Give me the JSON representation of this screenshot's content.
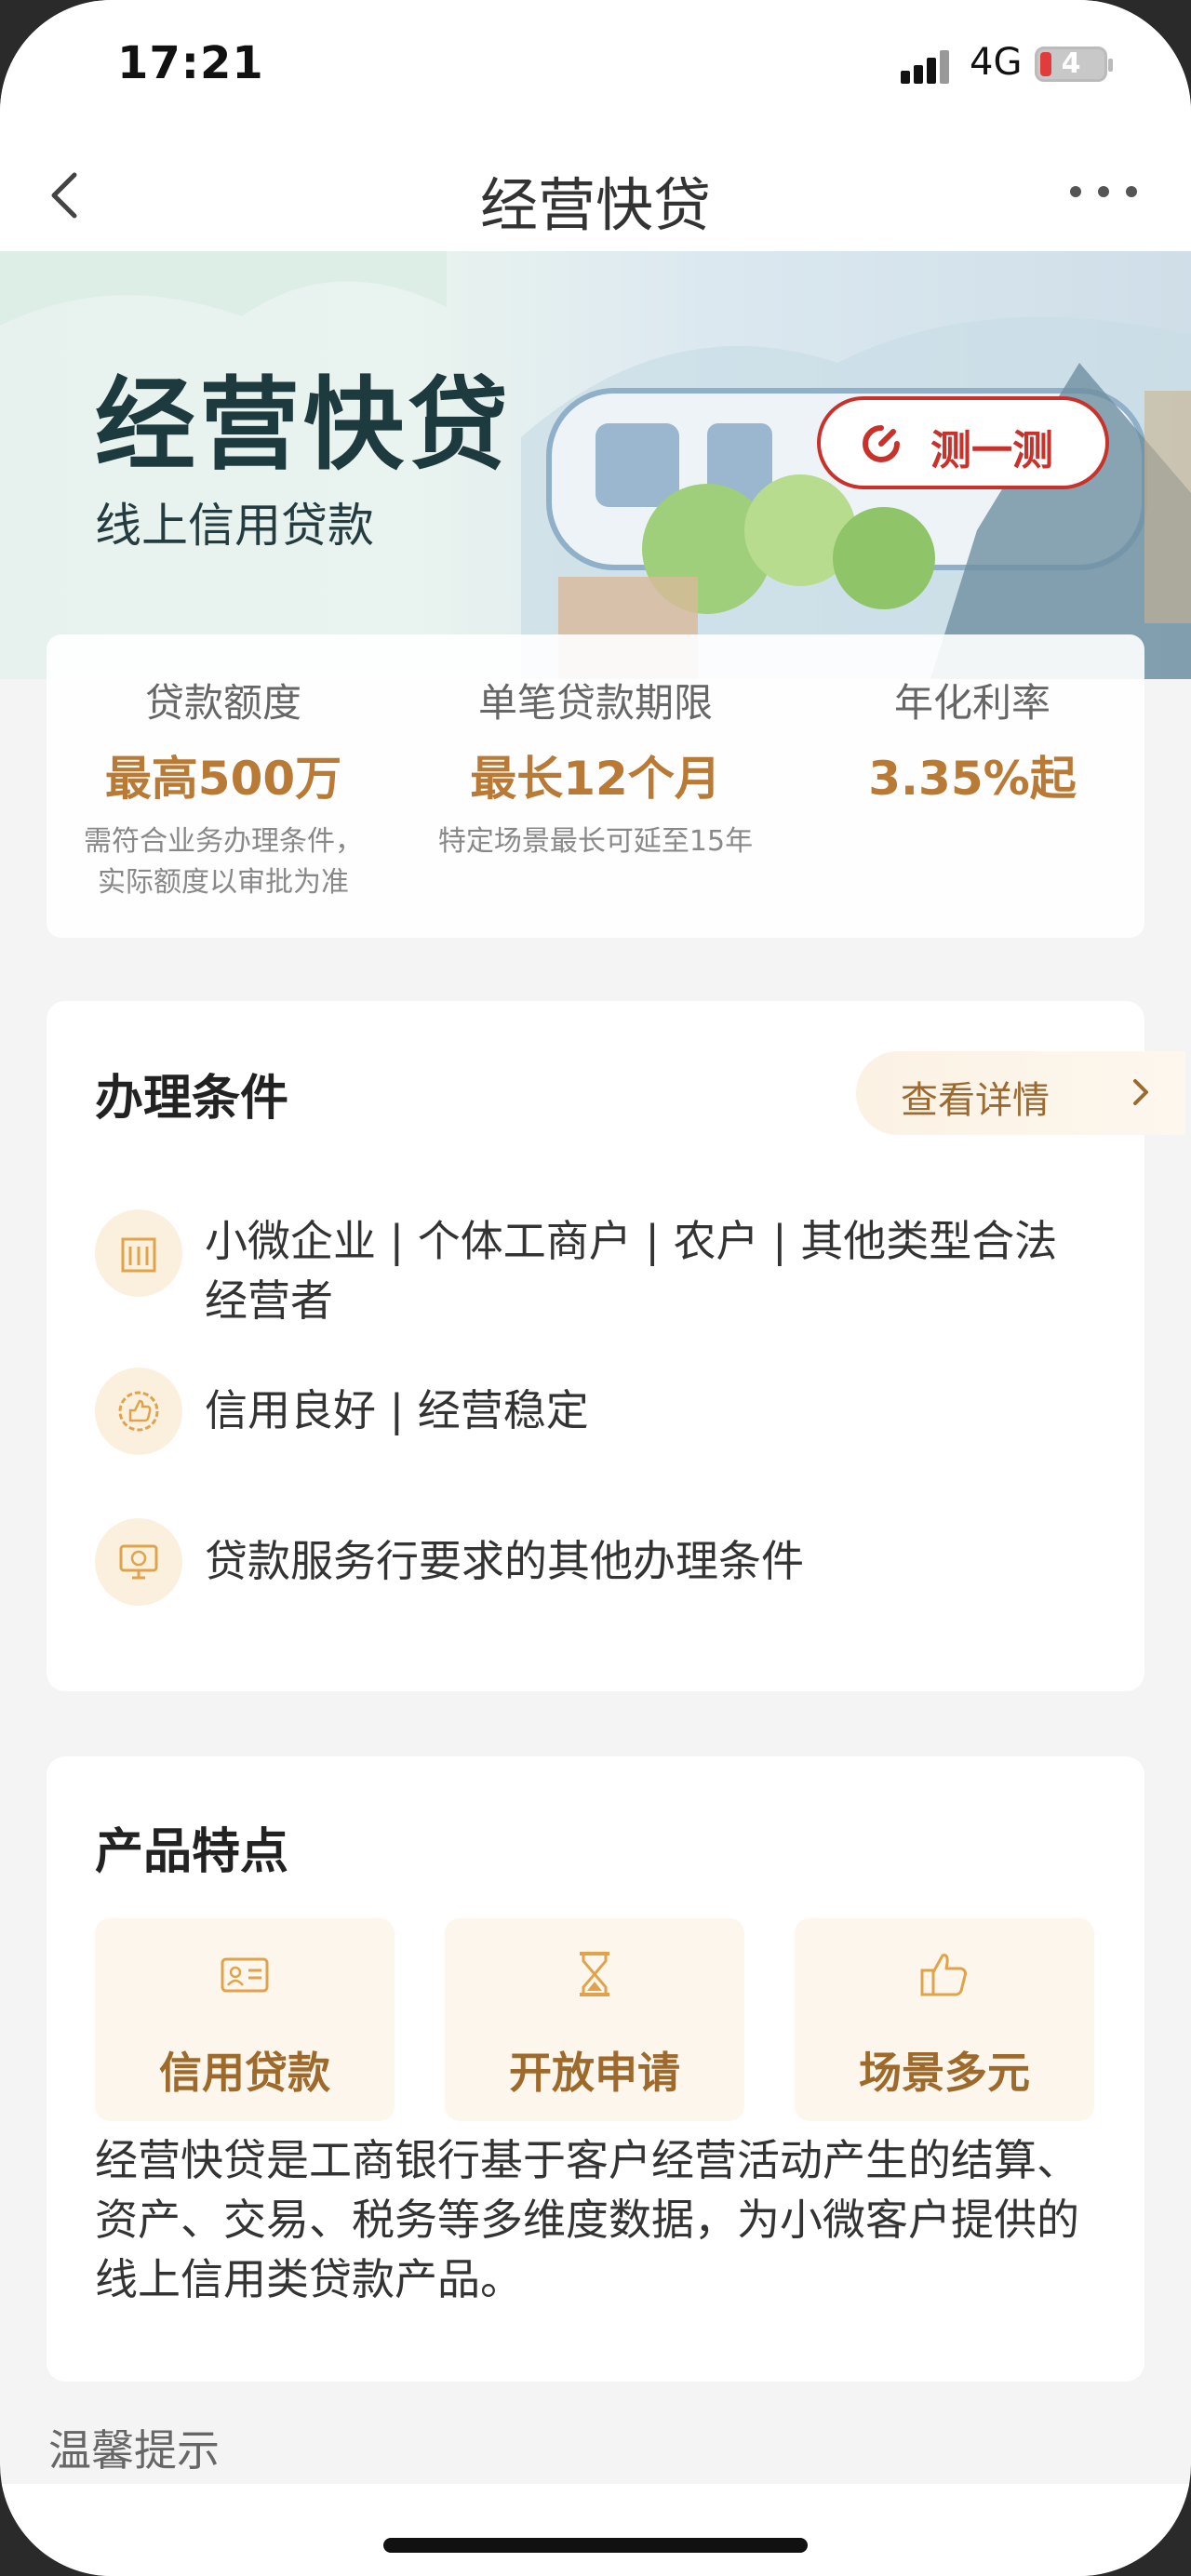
{
  "status_bar": {
    "time": "17:21",
    "network": "4G",
    "battery": "4"
  },
  "navbar": {
    "title": "经营快贷"
  },
  "hero": {
    "title": "经营快贷",
    "subtitle": "线上信用贷款",
    "test_button_label": "测一测"
  },
  "rates": [
    {
      "label": "贷款额度",
      "value": "最高500万",
      "note_line1": "需符合业务办理条件，",
      "note_line2": "实际额度以审批为准"
    },
    {
      "label": "单笔贷款期限",
      "value": "最长12个月",
      "note_line1": "特定场景最长可延至15年",
      "note_line2": ""
    },
    {
      "label": "年化利率",
      "value": "3.35%起",
      "note_line1": "",
      "note_line2": ""
    }
  ],
  "conditions": {
    "title": "办理条件",
    "detail_label": "查看详情",
    "items": [
      {
        "text": "小微企业 | 个体工商户 | 农户 | 其他类型合法经营者",
        "icon": "building-icon"
      },
      {
        "text": "信用良好 | 经营稳定",
        "icon": "thumbs-up-badge-icon"
      },
      {
        "text": "贷款服务行要求的其他办理条件",
        "icon": "monitor-coin-icon"
      }
    ]
  },
  "features": {
    "title": "产品特点",
    "items": [
      {
        "label": "信用贷款",
        "icon": "id-card-icon"
      },
      {
        "label": "开放申请",
        "icon": "hourglass-icon"
      },
      {
        "label": "场景多元",
        "icon": "thumbs-up-icon"
      }
    ],
    "description": "经营快贷是工商银行基于客户经营活动产生的结算、资产、交易、税务等多维度数据，为小微客户提供的线上信用类贷款产品。"
  },
  "tip_title": "温馨提示",
  "colors": {
    "accent_gold": "#b97a35",
    "brand_red": "#c9312b",
    "hero_text": "#1d3a3f"
  }
}
